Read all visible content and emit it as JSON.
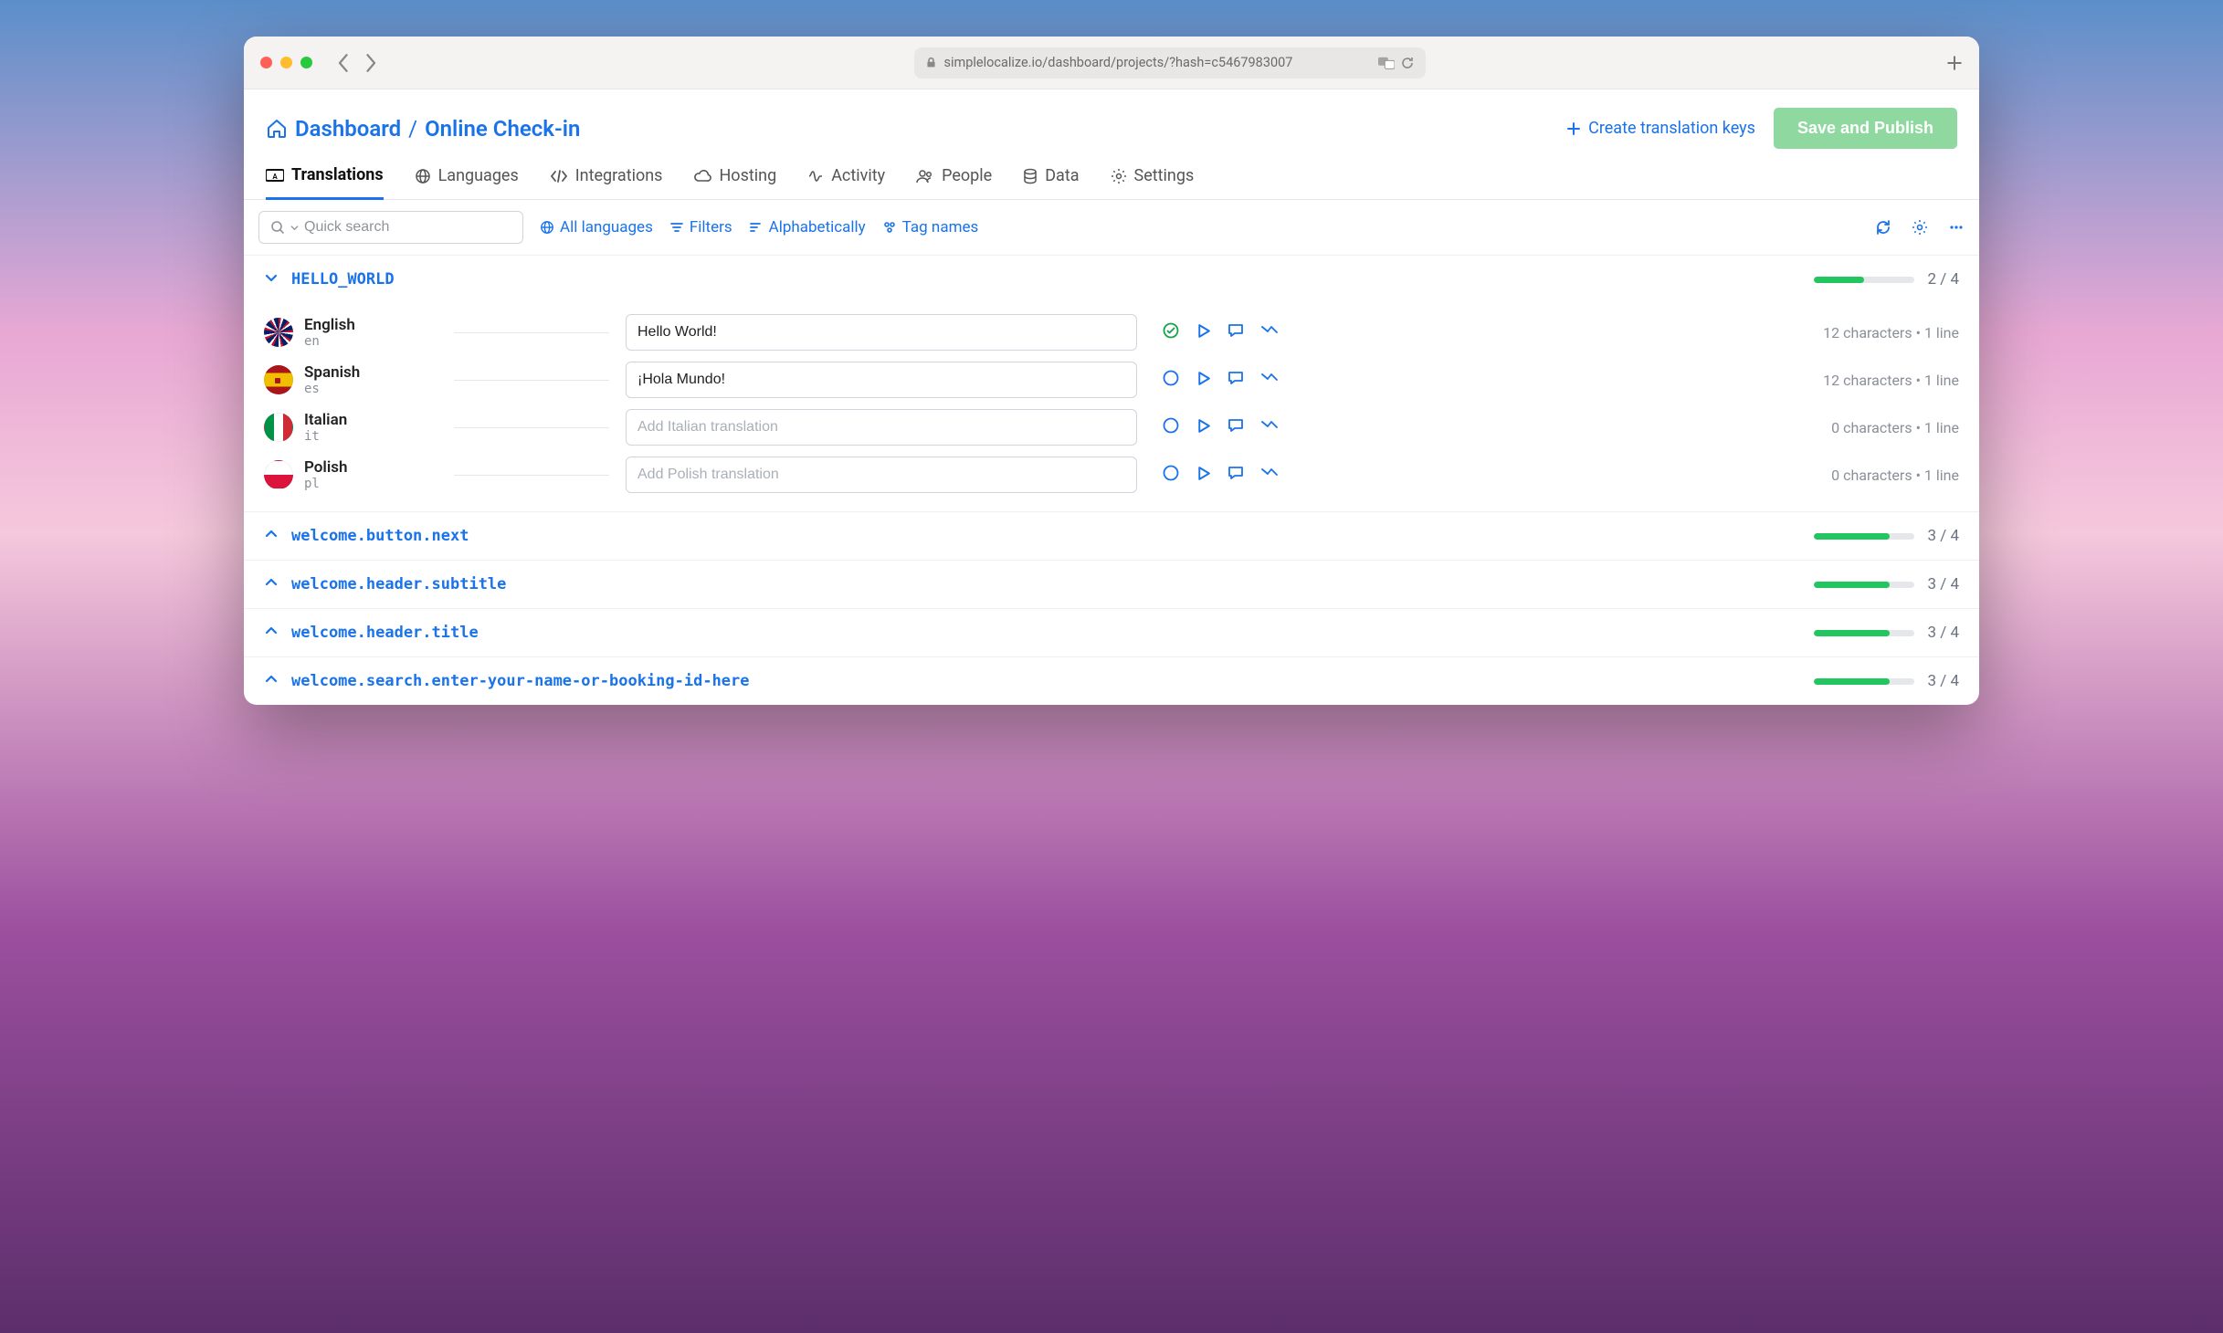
{
  "browser": {
    "url": "simplelocalize.io/dashboard/projects/?hash=c5467983007"
  },
  "header": {
    "crumb1": "Dashboard",
    "crumb2": "Online Check-in",
    "create_label": "Create translation keys",
    "publish_label": "Save and Publish"
  },
  "tabs": {
    "translations": "Translations",
    "languages": "Languages",
    "integrations": "Integrations",
    "hosting": "Hosting",
    "activity": "Activity",
    "people": "People",
    "data": "Data",
    "settings": "Settings"
  },
  "toolbar": {
    "search_placeholder": "Quick search",
    "all_languages": "All languages",
    "filters": "Filters",
    "alpha": "Alphabetically",
    "tag_names": "Tag names"
  },
  "keys": [
    {
      "name": "HELLO_WORLD",
      "expanded": true,
      "done": 2,
      "total": 4,
      "translations": [
        {
          "lang": "English",
          "code": "en",
          "flag": "en",
          "value": "Hello World!",
          "placeholder": "",
          "complete": true,
          "chars": 12,
          "lines": 1
        },
        {
          "lang": "Spanish",
          "code": "es",
          "flag": "es",
          "value": "¡Hola Mundo!",
          "placeholder": "",
          "complete": false,
          "chars": 12,
          "lines": 1
        },
        {
          "lang": "Italian",
          "code": "it",
          "flag": "it",
          "value": "",
          "placeholder": "Add Italian translation",
          "complete": false,
          "chars": 0,
          "lines": 1
        },
        {
          "lang": "Polish",
          "code": "pl",
          "flag": "pl",
          "value": "",
          "placeholder": "Add Polish translation",
          "complete": false,
          "chars": 0,
          "lines": 1
        }
      ]
    },
    {
      "name": "welcome.button.next",
      "expanded": false,
      "done": 3,
      "total": 4
    },
    {
      "name": "welcome.header.subtitle",
      "expanded": false,
      "done": 3,
      "total": 4
    },
    {
      "name": "welcome.header.title",
      "expanded": false,
      "done": 3,
      "total": 4
    },
    {
      "name": "welcome.search.enter-your-name-or-booking-id-here",
      "expanded": false,
      "done": 3,
      "total": 4
    }
  ],
  "meta": {
    "chars_label": "characters",
    "line_label": "line",
    "sep": "/"
  }
}
